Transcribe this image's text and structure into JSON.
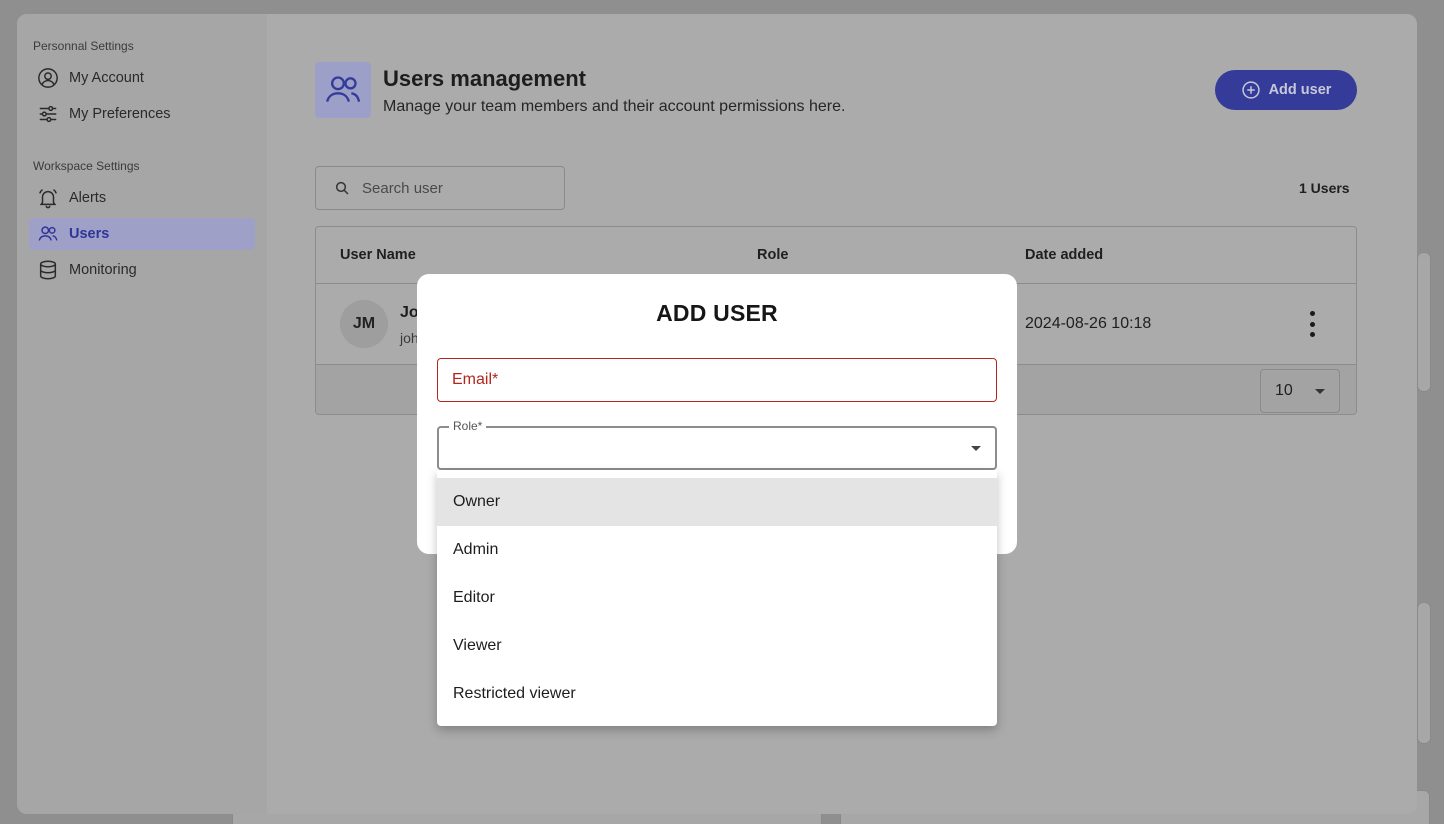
{
  "sidebar": {
    "personal_heading": "Personnal Settings",
    "workspace_heading": "Workspace Settings",
    "items": [
      {
        "label": "My Account",
        "icon": "user-circle-icon"
      },
      {
        "label": "My Preferences",
        "icon": "sliders-icon"
      },
      {
        "label": "Alerts",
        "icon": "bell-icon"
      },
      {
        "label": "Users",
        "icon": "users-icon",
        "active": true
      },
      {
        "label": "Monitoring",
        "icon": "database-icon"
      }
    ]
  },
  "header": {
    "title": "Users management",
    "subtitle": "Manage your team members and their account permissions here.",
    "add_user_label": "Add user"
  },
  "search": {
    "placeholder": "Search user"
  },
  "users_count": "1 Users",
  "table": {
    "columns": [
      "User Name",
      "Role",
      "Date added"
    ],
    "rows": [
      {
        "initials": "JM",
        "name": "Jo",
        "email": "joh",
        "date_added": "2024-08-26 10:18"
      }
    ],
    "rows_per_page": "10"
  },
  "modal": {
    "title": "ADD USER",
    "email_placeholder": "Email*",
    "role_label": "Role*",
    "role_options": [
      "Owner",
      "Admin",
      "Editor",
      "Viewer",
      "Restricted viewer"
    ],
    "highlighted_option": "Owner"
  },
  "colors": {
    "accent": "#343b98",
    "error": "#b3261e"
  }
}
